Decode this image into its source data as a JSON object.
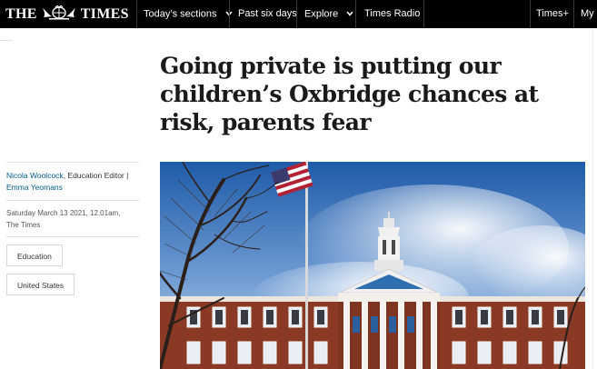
{
  "nav": {
    "logo_left": "THE",
    "logo_right": "TIMES",
    "items": [
      {
        "label": "Today’s sections",
        "has_dropdown": true
      },
      {
        "label": "Past six days",
        "has_dropdown": false
      },
      {
        "label": "Explore",
        "has_dropdown": true
      },
      {
        "label": "Times Radio",
        "has_dropdown": false
      }
    ],
    "right_items": [
      {
        "label": "Times+"
      },
      {
        "label": "My"
      }
    ]
  },
  "article": {
    "headline": "Going private is putting our children’s Oxbridge chances at risk, parents fear",
    "authors": [
      {
        "name": "Nicola Woolcock",
        "role": ", Education Editor |"
      },
      {
        "name": "Emma Yeomans"
      }
    ],
    "date": "Saturday March 13 2021, 12.01am,",
    "publication": "The Times",
    "tags": [
      "Education",
      "United States"
    ]
  },
  "colors": {
    "nav_bg": "#000000",
    "author_link": "#005c8a",
    "headline": "#1a1a1a"
  }
}
